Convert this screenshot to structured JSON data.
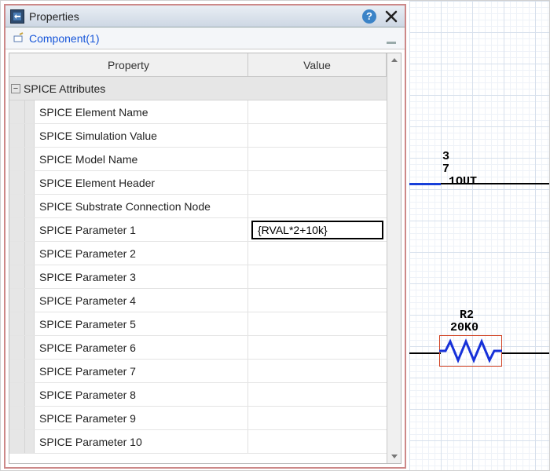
{
  "titlebar": {
    "title": "Properties"
  },
  "subbar": {
    "component_link": "Component(1)"
  },
  "grid": {
    "headers": {
      "property": "Property",
      "value": "Value"
    },
    "group_label": "SPICE Attributes",
    "rows": [
      {
        "label": "SPICE Element Name",
        "value": ""
      },
      {
        "label": "SPICE Simulation Value",
        "value": ""
      },
      {
        "label": "SPICE Model Name",
        "value": ""
      },
      {
        "label": "SPICE Element Header",
        "value": ""
      },
      {
        "label": "SPICE Substrate Connection Node",
        "value": ""
      },
      {
        "label": "SPICE Parameter 1",
        "value": "{RVAL*2+10k}"
      },
      {
        "label": "SPICE Parameter 2",
        "value": ""
      },
      {
        "label": "SPICE Parameter 3",
        "value": ""
      },
      {
        "label": "SPICE Parameter 4",
        "value": ""
      },
      {
        "label": "SPICE Parameter 5",
        "value": ""
      },
      {
        "label": "SPICE Parameter 6",
        "value": ""
      },
      {
        "label": "SPICE Parameter 7",
        "value": ""
      },
      {
        "label": "SPICE Parameter 8",
        "value": ""
      },
      {
        "label": "SPICE Parameter 9",
        "value": ""
      },
      {
        "label": "SPICE Parameter 10",
        "value": ""
      }
    ]
  },
  "schematic": {
    "pin_labels": {
      "a": "3",
      "b": "7",
      "net": "1OUT"
    },
    "resistor": {
      "ref": "R2",
      "value": "20K0"
    }
  }
}
